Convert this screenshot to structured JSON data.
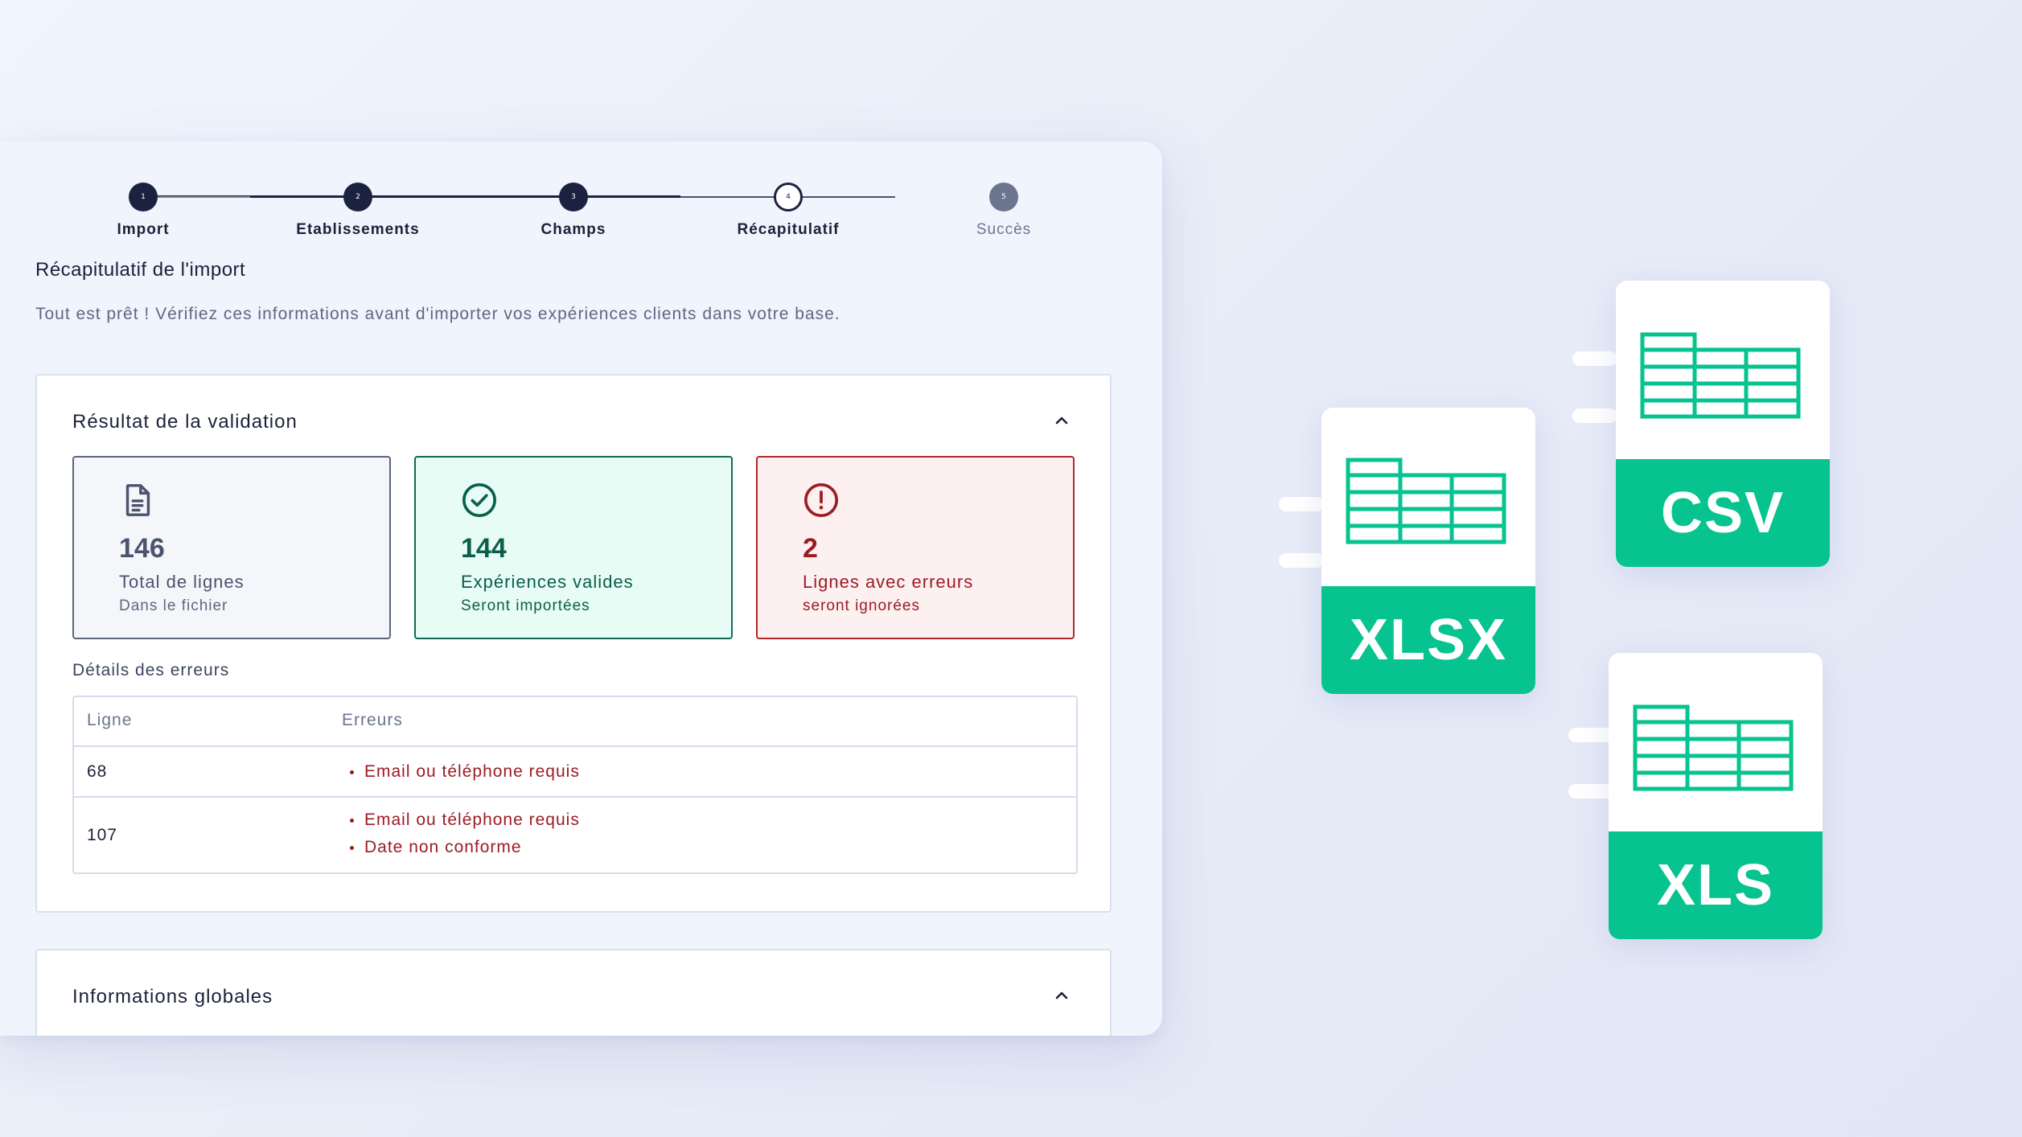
{
  "stepper": {
    "steps": [
      {
        "num": "1",
        "label": "Import",
        "state": "done"
      },
      {
        "num": "2",
        "label": "Etablissements",
        "state": "done"
      },
      {
        "num": "3",
        "label": "Champs",
        "state": "done"
      },
      {
        "num": "4",
        "label": "Récapitulatif",
        "state": "current"
      },
      {
        "num": "5",
        "label": "Succès",
        "state": "todo"
      }
    ]
  },
  "page": {
    "title": "Récapitulatif de l'import",
    "description": "Tout est prêt ! Vérifiez ces informations avant d'importer vos expériences clients dans votre base."
  },
  "validation": {
    "title": "Résultat de la validation",
    "stats": {
      "total": {
        "value": "146",
        "label": "Total de lignes",
        "sub": "Dans le fichier",
        "icon": "file-text-icon"
      },
      "valid": {
        "value": "144",
        "label": "Expériences valides",
        "sub": "Seront importées",
        "icon": "check-circle-icon"
      },
      "errors": {
        "value": "2",
        "label": "Lignes avec erreurs",
        "sub": "seront ignorées",
        "icon": "alert-circle-icon"
      }
    },
    "errors_title": "Détails des erreurs",
    "table": {
      "headers": [
        "Ligne",
        "Erreurs"
      ],
      "rows": [
        {
          "line": "68",
          "errors": [
            "Email ou téléphone requis"
          ]
        },
        {
          "line": "107",
          "errors": [
            "Email ou téléphone requis",
            "Date non conforme"
          ]
        }
      ]
    }
  },
  "global": {
    "title": "Informations globales"
  },
  "files": {
    "xlsx": "XLSX",
    "csv": "CSV",
    "xls": "XLS"
  },
  "colors": {
    "accent_green": "#06c38f",
    "navy": "#1b2240",
    "error_red": "#9c1c24",
    "valid_green": "#0b5e4c"
  }
}
